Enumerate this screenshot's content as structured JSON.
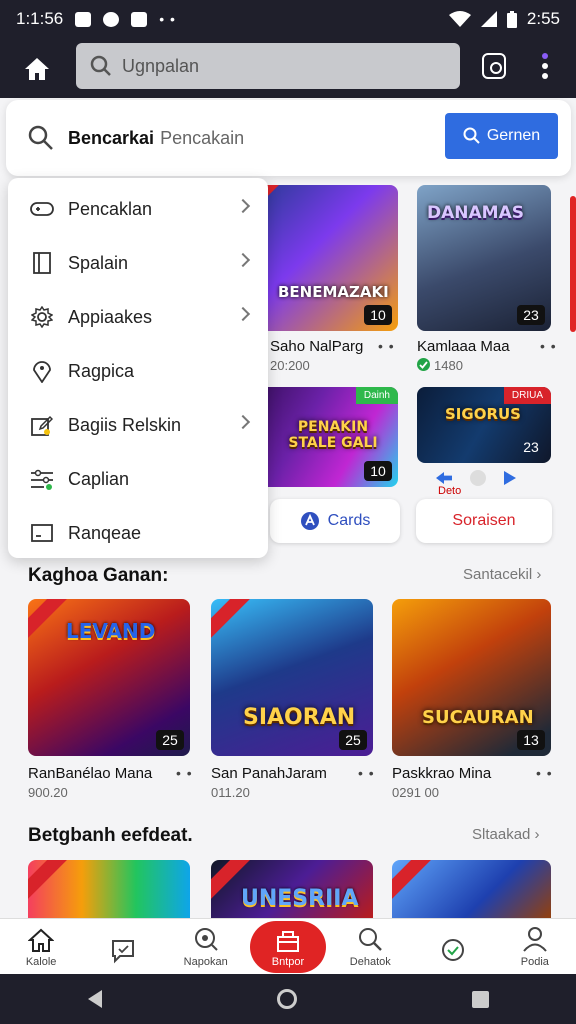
{
  "status": {
    "time": "1:1:56",
    "clock": "2:55"
  },
  "topbar": {
    "search_placeholder": "Ugnpalan"
  },
  "search": {
    "query": "Bencarkai",
    "placeholder": "Pencakain",
    "button_label": "Gernen"
  },
  "menu": {
    "items": [
      {
        "label": "Pencaklan",
        "icon": "controller-icon"
      },
      {
        "label": "Spalain",
        "icon": "book-icon"
      },
      {
        "label": "Appiaakes",
        "icon": "gear-icon"
      },
      {
        "label": "Ragpica",
        "icon": "location-icon"
      },
      {
        "label": "Bagiis Relskin",
        "icon": "edit-icon"
      },
      {
        "label": "Caplian",
        "icon": "sliders-icon"
      },
      {
        "label": "Ranqeae",
        "icon": "window-icon"
      }
    ]
  },
  "featured": [
    {
      "art": "BENEMAZAKI",
      "badge": "10",
      "title": "Saho NalParg",
      "sub": "20:200"
    },
    {
      "art": "DANAMAS",
      "badge": "23",
      "title": "Kamlaaa Maa",
      "sub": "1480"
    },
    {
      "art": "PENAKIN STALE GALI",
      "badge": "10",
      "ribbon": "Dainh"
    },
    {
      "art": "SIGORUS",
      "badge": "23",
      "ribbon": "DRIUA"
    }
  ],
  "pills": {
    "cards_label": "Cards",
    "social_label": "Soraisen",
    "score_text": "Deto"
  },
  "section1": {
    "title": "Kaghoa Ganan:",
    "see_all": "Santacekil",
    "items": [
      {
        "art": "LEVAND",
        "badge": "25",
        "title": "RanBanélao Mana",
        "sub": "900.20"
      },
      {
        "art": "SIAORAN",
        "badge": "25",
        "title": "San PanahJaram",
        "sub": "011.20"
      },
      {
        "art": "SUCAURAN",
        "badge": "13",
        "title": "Paskkrao Mina",
        "sub": "0291 00"
      }
    ]
  },
  "section2": {
    "title": "Betgbanh eefdeat.",
    "see_all": "Sltaakad",
    "items": [
      {
        "art": ""
      },
      {
        "art": "UNESRIIA"
      },
      {
        "art": ""
      }
    ]
  },
  "bottomnav": [
    {
      "label": "Kalole",
      "icon": "home-icon"
    },
    {
      "label": "",
      "icon": "chat-icon"
    },
    {
      "label": "Napokan",
      "icon": "search-alt-icon"
    },
    {
      "label": "Bntpor",
      "icon": "gift-icon",
      "active": true
    },
    {
      "label": "Dehatok",
      "icon": "search-icon"
    },
    {
      "label": "",
      "icon": "speech-icon"
    },
    {
      "label": "Podia",
      "icon": "profile-icon"
    }
  ],
  "colors": {
    "accent": "#e02424",
    "search_button": "#2f6ce0",
    "topbar": "#1f1f2b"
  }
}
